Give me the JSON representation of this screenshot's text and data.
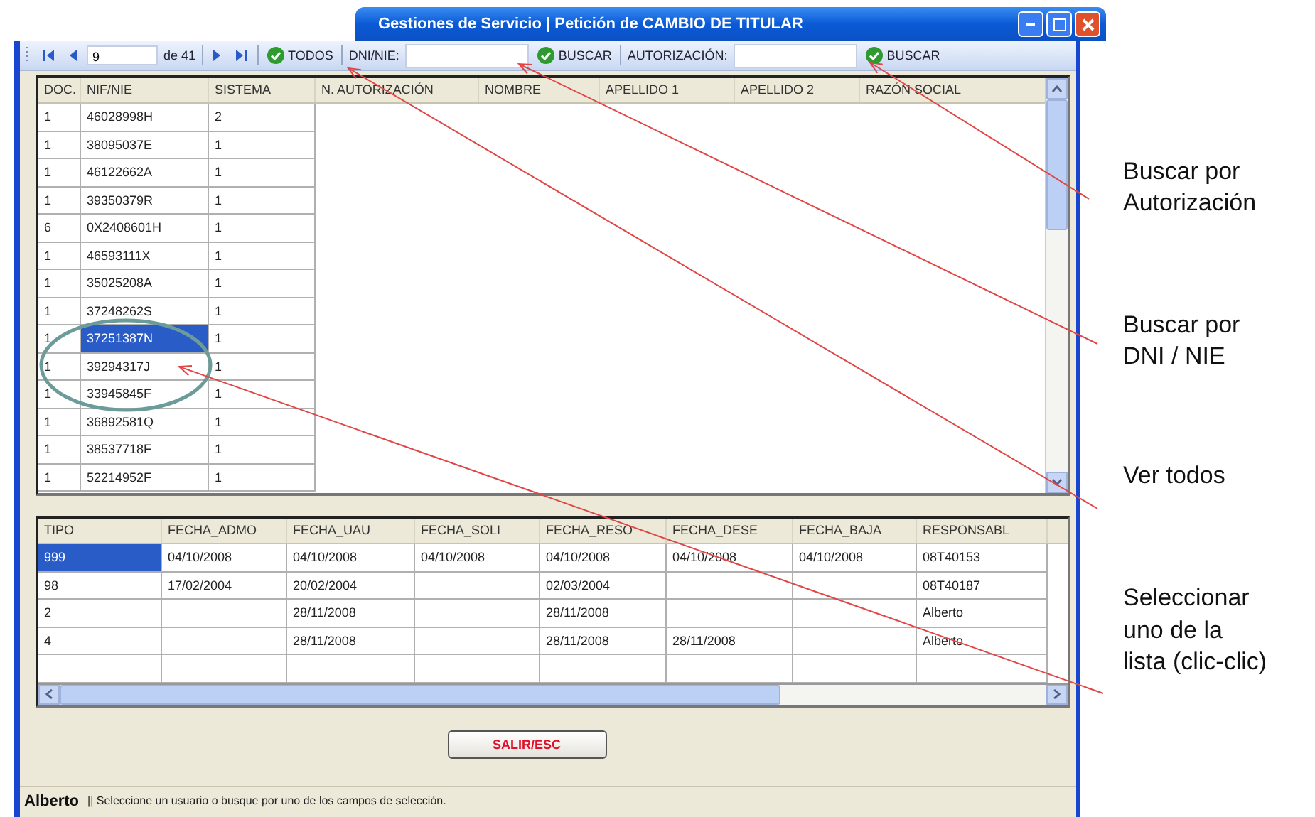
{
  "window": {
    "title": "Gestiones de Servicio | Petición de CAMBIO DE TITULAR"
  },
  "toolbar": {
    "record": "9",
    "record_count": "de 41",
    "show_all_button": "TODOS",
    "searches": [
      {
        "label": "DNI/NIE:",
        "button": "BUSCAR"
      },
      {
        "label": "AUTORIZACIÓN:",
        "button": "BUSCAR"
      }
    ]
  },
  "upper_table": {
    "columns": [
      "DOC.",
      "NIF/NIE",
      "SISTEMA",
      "N. AUTORIZACIÓN",
      "NOMBRE",
      "APELLIDO 1",
      "APELLIDO 2",
      "RAZÓN SOCIAL"
    ],
    "rows": [
      {
        "cells": [
          "1",
          "46028998H",
          "2"
        ],
        "selected": false
      },
      {
        "cells": [
          "1",
          "38095037E",
          "1"
        ],
        "selected": false
      },
      {
        "cells": [
          "1",
          "46122662A",
          "1"
        ],
        "selected": false
      },
      {
        "cells": [
          "1",
          "39350379R",
          "1"
        ],
        "selected": false
      },
      {
        "cells": [
          "6",
          "0X2408601H",
          "1"
        ],
        "selected": false
      },
      {
        "cells": [
          "1",
          "46593111X",
          "1"
        ],
        "selected": false
      },
      {
        "cells": [
          "1",
          "35025208A",
          "1"
        ],
        "selected": false
      },
      {
        "cells": [
          "1",
          "37248262S",
          "1"
        ],
        "selected": false
      },
      {
        "cells": [
          "1",
          "37251387N",
          "1"
        ],
        "selected": true
      },
      {
        "cells": [
          "1",
          "39294317J",
          "1"
        ],
        "selected": false
      },
      {
        "cells": [
          "1",
          "33945845F",
          "1"
        ],
        "selected": false
      },
      {
        "cells": [
          "1",
          "36892581Q",
          "1"
        ],
        "selected": false
      },
      {
        "cells": [
          "1",
          "38537718F",
          "1"
        ],
        "selected": false
      },
      {
        "cells": [
          "1",
          "52214952F",
          "1"
        ],
        "selected": false
      }
    ]
  },
  "lower_table": {
    "columns": [
      "TIPO",
      "FECHA_ADMO",
      "FECHA_UAU",
      "FECHA_SOLI",
      "FECHA_RESO",
      "FECHA_DESE",
      "FECHA_BAJA",
      "RESPONSABL"
    ],
    "rows": [
      {
        "cells": [
          "999",
          "04/10/2008",
          "04/10/2008",
          "04/10/2008",
          "04/10/2008",
          "04/10/2008",
          "04/10/2008",
          "08T40153"
        ],
        "selected": true
      },
      {
        "cells": [
          "98",
          "17/02/2004",
          "20/02/2004",
          null,
          "02/03/2004",
          null,
          null,
          "08T40187"
        ],
        "selected": false
      },
      {
        "cells": [
          "2",
          null,
          "28/11/2008",
          null,
          "28/11/2008",
          null,
          null,
          "Alberto"
        ],
        "selected": false
      },
      {
        "cells": [
          "4",
          null,
          "28/11/2008",
          null,
          "28/11/2008",
          "28/11/2008",
          null,
          "Alberto"
        ],
        "selected": false
      }
    ]
  },
  "exit_button": "SALIR/ESC",
  "status_bar": {
    "user": "Alberto",
    "message": "|| Seleccione un usuario o busque por uno de los campos de selección."
  },
  "annotations": [
    {
      "text": "Buscar por\nAutorización"
    },
    {
      "text": "Buscar por\nDNI / NIE"
    },
    {
      "text": "Ver todos"
    },
    {
      "text": "Seleccionar\nuno de la\nlista (clic-clic)"
    }
  ]
}
